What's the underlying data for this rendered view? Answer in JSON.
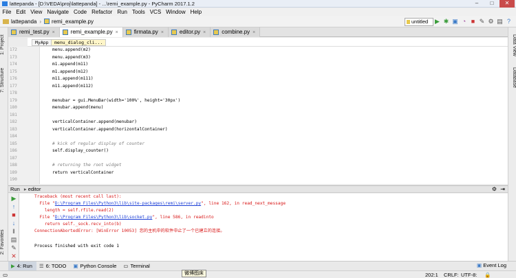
{
  "window": {
    "title": "lattepanda - [D:\\VEDA\\proj\\lattepanda] - ...\\remi_example.py - PyCharm 2017.1.2",
    "controls": [
      "–",
      "□",
      "✕"
    ]
  },
  "menu": [
    "File",
    "Edit",
    "View",
    "Navigate",
    "Code",
    "Refactor",
    "Run",
    "Tools",
    "VCS",
    "Window",
    "Help"
  ],
  "navbar": {
    "project": "lattepanda",
    "file": "remi_example.py",
    "run_config": "untitled"
  },
  "left_tabs": [
    "1: Project",
    "7: Structure",
    "2: Favorites"
  ],
  "right_tabs": [
    "Data View",
    "Database"
  ],
  "tabs": [
    {
      "label": "remi_test.py",
      "active": false
    },
    {
      "label": "remi_example.py",
      "active": true
    },
    {
      "label": "firmata.py",
      "active": false
    },
    {
      "label": "editor.py",
      "active": false
    },
    {
      "label": "combine.py",
      "active": false
    }
  ],
  "breadcrumb": [
    "MyApp",
    "menu_dialog_cli..."
  ],
  "code_lines": [
    {
      "n": "172",
      "text": "menu.append(m2)",
      "indent": 0,
      "comment": false
    },
    {
      "n": "173",
      "text": "menu.append(m3)",
      "indent": 0,
      "comment": false
    },
    {
      "n": "174",
      "text": "m1.append(m11)",
      "indent": 0,
      "comment": false
    },
    {
      "n": "175",
      "text": "m1.append(m12)",
      "indent": 0,
      "comment": false
    },
    {
      "n": "176",
      "text": "m11.append(m111)",
      "indent": 0,
      "comment": false
    },
    {
      "n": "177",
      "text": "m11.append(m112)",
      "indent": 0,
      "comment": false
    },
    {
      "n": "178",
      "text": "",
      "indent": 0,
      "comment": false
    },
    {
      "n": "179",
      "text": "menubar = gui.MenuBar(width='100%', height='30px')",
      "indent": 0,
      "comment": false
    },
    {
      "n": "180",
      "text": "menubar.append(menu)",
      "indent": 0,
      "comment": false
    },
    {
      "n": "181",
      "text": "",
      "indent": 0,
      "comment": false
    },
    {
      "n": "182",
      "text": "verticalContainer.append(menubar)",
      "indent": 0,
      "comment": false
    },
    {
      "n": "183",
      "text": "verticalContainer.append(horizontalContainer)",
      "indent": 0,
      "comment": false
    },
    {
      "n": "184",
      "text": "",
      "indent": 0,
      "comment": false
    },
    {
      "n": "185",
      "text": "# kick of regular display of counter",
      "indent": 0,
      "comment": true
    },
    {
      "n": "186",
      "text": "self.display_counter()",
      "indent": 0,
      "comment": false
    },
    {
      "n": "187",
      "text": "",
      "indent": 0,
      "comment": false
    },
    {
      "n": "188",
      "text": "# returning the root widget",
      "indent": 0,
      "comment": true
    },
    {
      "n": "189",
      "text": "return verticalContainer",
      "indent": 0,
      "comment": false
    },
    {
      "n": "190",
      "text": "",
      "indent": 0,
      "comment": false
    }
  ],
  "run_panel": {
    "label": "Run",
    "config": "editor"
  },
  "console": {
    "lines": [
      {
        "pre": "Traceback (most recent call last):",
        "link": "",
        "post": ""
      },
      {
        "pre": "  File \"",
        "link": "D:\\Program Files\\Python3\\lib\\site-packages\\remi\\server.py",
        "post": "\", line 162, in read_next_message"
      },
      {
        "pre": "    length = self.rfile.read(2)",
        "link": "",
        "post": ""
      },
      {
        "pre": "  File \"",
        "link": "D:\\Program Files\\Python3\\lib\\socket.py",
        "post": "\", line 586, in readinto"
      },
      {
        "pre": "    return self._sock.recv_into(b)",
        "link": "",
        "post": ""
      },
      {
        "pre": "ConnectionAbortedError: [WinError 10053] 您的主机中的软件中止了一个已建立的连接。",
        "link": "",
        "post": ""
      }
    ],
    "finish": "Process finished with exit code 1"
  },
  "bottom_tabs": [
    {
      "label": "4: Run",
      "active": true
    },
    {
      "label": "6: TODO",
      "active": false
    },
    {
      "label": "Python Console",
      "active": false
    },
    {
      "label": "Terminal",
      "active": false
    }
  ],
  "event_log": "Event Log",
  "status": {
    "position": "202:1",
    "line_sep": "CRLF:",
    "encoding": "UTF-8:"
  },
  "tooltip": "微博图床"
}
